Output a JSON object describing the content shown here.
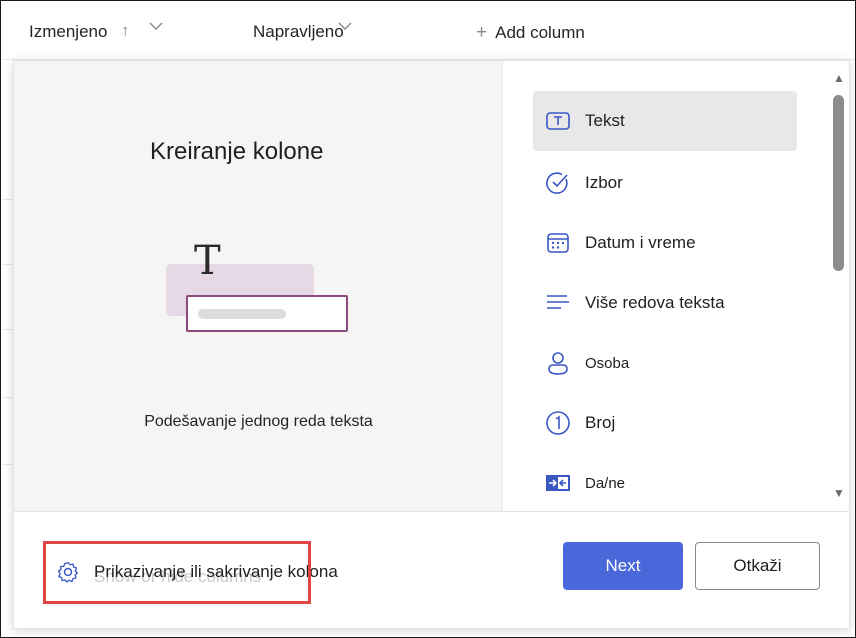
{
  "list_header": {
    "columns": [
      {
        "label": "Izmenjeno",
        "sort": "ascending"
      },
      {
        "label": "Napravljeno"
      }
    ],
    "add_column_label": "Add column"
  },
  "panel": {
    "title": "Kreiranje kolone",
    "preview": {
      "glyph": "T",
      "description": "Podešavanje jednog reda teksta"
    },
    "column_types": [
      {
        "label": "Tekst",
        "icon": "text-box-icon",
        "selected": true
      },
      {
        "label": "Izbor",
        "icon": "choice-check-icon"
      },
      {
        "label": "Datum i vreme",
        "icon": "calendar-icon"
      },
      {
        "label": "Više redova teksta",
        "icon": "multiline-text-icon"
      },
      {
        "label": "Osoba",
        "icon": "person-icon"
      },
      {
        "label": "Broj",
        "icon": "number-icon"
      },
      {
        "label": "Da/ne",
        "icon": "yes-no-toggle-icon"
      }
    ],
    "footer": {
      "show_hide_label": "Prikazivanje ili sakrivanje kolona",
      "show_hide_ghost": "Show or hide columns",
      "next_label": "Next",
      "cancel_label": "Otkaži"
    }
  },
  "colors": {
    "accent": "#4a68d9",
    "illustration_border": "#8a4a7c",
    "illustration_fill": "#e6d9e5",
    "highlight": "#e04444",
    "icon_blue": "#3a57c4"
  }
}
